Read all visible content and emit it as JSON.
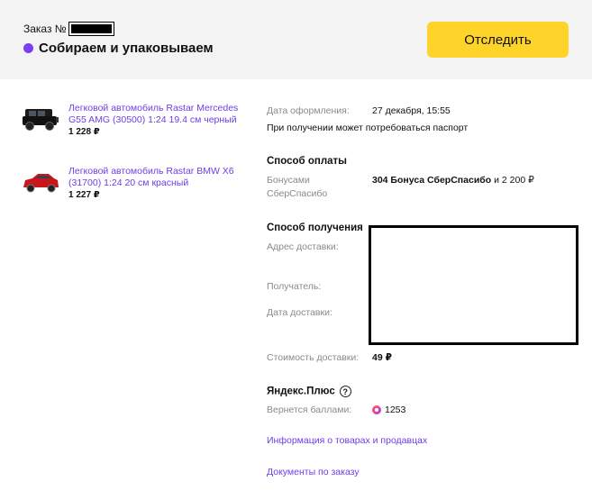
{
  "header": {
    "order_label": "Заказ №",
    "status_text": "Собираем и упаковываем",
    "track_button": "Отследить",
    "status_color": "#7a3ff2",
    "button_color": "#fed42b"
  },
  "items": [
    {
      "title": "Легковой автомобиль Rastar Mercedes G55 AMG (30500) 1:24 19.4 см черный",
      "price": "1 228 ₽",
      "icon": "black-suv-icon"
    },
    {
      "title": "Легковой автомобиль Rastar BMW X6 (31700) 1:24 20 см красный",
      "price": "1 227 ₽",
      "icon": "red-suv-icon"
    }
  ],
  "details": {
    "order_date_label": "Дата оформления:",
    "order_date_value": "27 декабря, 15:55",
    "passport_note": "При получении может потребоваться паспорт",
    "payment_title": "Способ оплаты",
    "payment_label_line1": "Бонусами",
    "payment_label_line2": "СберСпасибо",
    "payment_bonus": "304 Бонуса СберСпасибо",
    "payment_rest": " и 2 200 ₽",
    "delivery_title": "Способ получения",
    "address_label": "Адрес доставки:",
    "recipient_label": "Получатель:",
    "delivery_date_label": "Дата доставки:",
    "delivery_cost_label": "Стоимость доставки:",
    "delivery_cost_value": "49 ₽",
    "plus_title": "Яндекс.Плюс",
    "plus_help": "?",
    "cashback_label": "Вернется баллами:",
    "cashback_value": "1253",
    "info_link": "Информация о товарах и продавцах",
    "docs_link": "Документы по заказу"
  },
  "colors": {
    "link": "#6c3ee8",
    "muted": "#8a8a8a"
  }
}
